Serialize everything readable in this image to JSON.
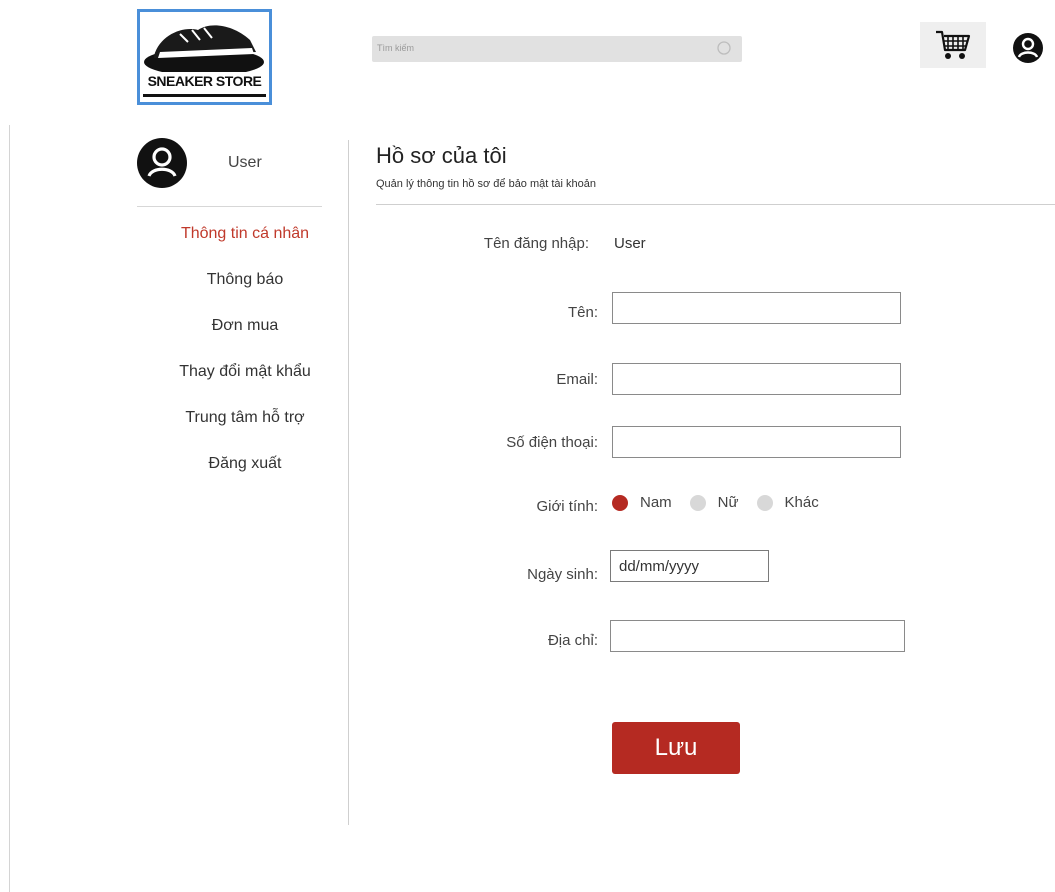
{
  "header": {
    "logo_text": "SNEAKER STORE",
    "search_placeholder": "Tìm kiếm"
  },
  "sidebar": {
    "username": "User",
    "items": [
      {
        "label": "Thông tin cá nhân",
        "active": true
      },
      {
        "label": "Thông báo",
        "active": false
      },
      {
        "label": "Đơn mua",
        "active": false
      },
      {
        "label": "Thay đổi mật khẩu",
        "active": false
      },
      {
        "label": "Trung tâm hỗ trợ",
        "active": false
      },
      {
        "label": "Đăng xuất",
        "active": false
      }
    ]
  },
  "main": {
    "title": "Hồ sơ của tôi",
    "subtitle": "Quản lý thông tin hồ sơ để bảo mật tài khoản",
    "username_label": "Tên đăng nhập:",
    "username_value": "User",
    "name_label": "Tên:",
    "name_value": "",
    "email_label": "Email:",
    "email_value": "",
    "phone_label": "Số điện thoại:",
    "phone_value": "",
    "gender_label": "Giới tính:",
    "gender_options": [
      "Nam",
      "Nữ",
      "Khác"
    ],
    "gender_selected": "Nam",
    "dob_label": "Ngày sinh:",
    "dob_placeholder": "dd/mm/yyyy",
    "address_label": "Địa chỉ:",
    "address_value": "",
    "save_label": "Lưu"
  },
  "colors": {
    "accent": "#b52a22",
    "logo_border": "#4a8fd9"
  }
}
